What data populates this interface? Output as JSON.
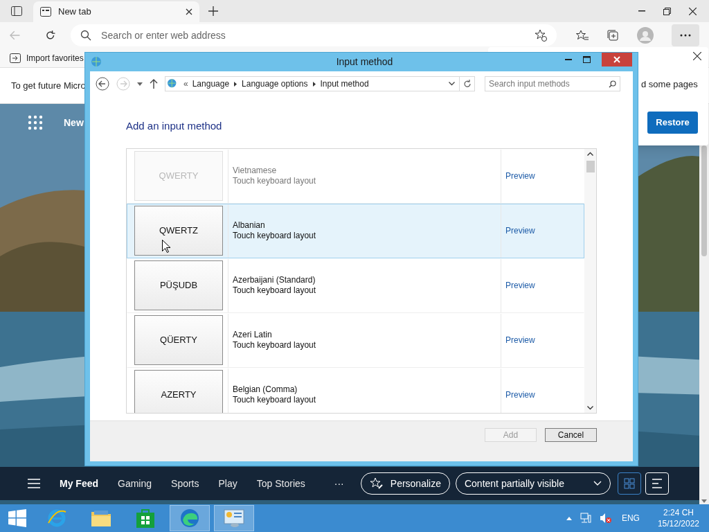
{
  "browser": {
    "tab": {
      "title": "New tab"
    },
    "address": {
      "placeholder": "Search or enter web address"
    },
    "favorites": [
      "Import favorites"
    ],
    "infobar": {
      "text": "To get future Micro"
    },
    "restore_popup": {
      "text": "d some pages",
      "button": "Restore"
    }
  },
  "new_tab": {
    "label": "New",
    "feed_nav": [
      {
        "label": "My Feed",
        "selected": true
      },
      {
        "label": "Gaming",
        "selected": false
      },
      {
        "label": "Sports",
        "selected": false
      },
      {
        "label": "Play",
        "selected": false
      },
      {
        "label": "Top Stories",
        "selected": false
      }
    ],
    "more": "···",
    "personalize": "Personalize",
    "visibility": "Content partially visible",
    "views": [
      {
        "kind": "grid",
        "selected": true
      },
      {
        "kind": "list",
        "selected": false
      }
    ]
  },
  "dialog": {
    "title": "Input method",
    "breadcrumb_prefix": "«",
    "breadcrumb": [
      "Language",
      "Language options",
      "Input method"
    ],
    "search": {
      "placeholder": "Search input methods"
    },
    "heading": "Add an input method",
    "rows": [
      {
        "key": "QWERTY",
        "language": "Vietnamese",
        "layout": "Touch keyboard layout",
        "preview": "Preview",
        "disabled": true,
        "selected": false
      },
      {
        "key": "QWERTZ",
        "language": "Albanian",
        "layout": "Touch keyboard layout",
        "preview": "Preview",
        "disabled": false,
        "selected": true
      },
      {
        "key": "PÜŞUDB",
        "language": "Azerbaijani (Standard)",
        "layout": "Touch keyboard layout",
        "preview": "Preview",
        "disabled": false,
        "selected": false
      },
      {
        "key": "QÜERTY",
        "language": "Azeri Latin",
        "layout": "Touch keyboard layout",
        "preview": "Preview",
        "disabled": false,
        "selected": false
      },
      {
        "key": "AZERTY",
        "language": "Belgian (Comma)",
        "layout": "Touch keyboard layout",
        "preview": "Preview",
        "disabled": false,
        "selected": false
      }
    ],
    "buttons": [
      {
        "label": "Add",
        "disabled": true
      },
      {
        "label": "Cancel",
        "disabled": false
      }
    ]
  },
  "taskbar": {
    "apps": [
      {
        "kind": "ie",
        "selected": false
      },
      {
        "kind": "explorer",
        "selected": false
      },
      {
        "kind": "store",
        "selected": false
      },
      {
        "kind": "edge",
        "selected": true
      },
      {
        "kind": "control",
        "selected": true
      }
    ],
    "language": "ENG",
    "time": "2:24 CH",
    "date": "15/12/2022"
  }
}
